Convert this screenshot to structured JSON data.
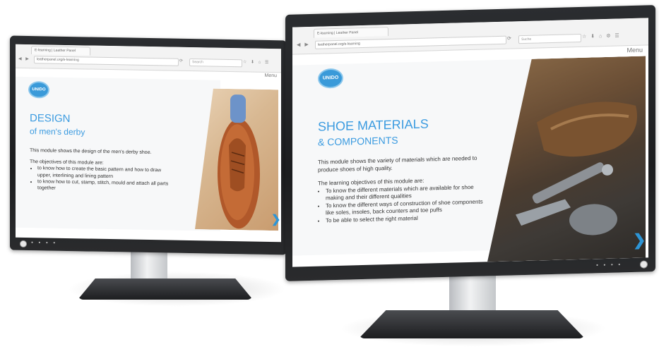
{
  "left": {
    "tab_title": "E-learning | Leather Panel",
    "url": "leatherpanel.org/e-learning",
    "search_placeholder": "Search",
    "menu_label": "Menu",
    "logo_text": "UNIDO",
    "title": "DESIGN",
    "subtitle": "of men's derby",
    "intro": "This module shows the design of the men's derby shoe.",
    "objectives_heading": "The objectives of this module are:",
    "objectives": [
      "to know how to create the basic pattern and how to draw upper, interlining and lining pattern",
      "to know how to cut, stamp, stitch, mould and attach all parts together"
    ],
    "next_glyph": "❯",
    "taskbar": "● ● ● ●"
  },
  "right": {
    "tab_title": "E-learning | Leather Panel",
    "url": "leatherpanel.org/e-learning",
    "search_placeholder": "Suche",
    "menu_label": "Menu",
    "logo_text": "UNIDO",
    "title": "SHOE MATERIALS",
    "subtitle": "& COMPONENTS",
    "intro": "This module shows the variety of materials which are needed to produce shoes of high quality.",
    "objectives_heading": "The learning objectives of this module are:",
    "objectives": [
      "To know the different materials which are available for shoe making and their different qualities",
      "To know the different ways of construction of shoe components like soles, insoles, back counters and toe puffs",
      "To be able to select the right material"
    ],
    "next_glyph": "❯",
    "taskbar": "● ● ● ●"
  },
  "colors": {
    "accent": "#3b9be0",
    "bezel": "#1f2022",
    "arrow": "#2d95d6"
  }
}
